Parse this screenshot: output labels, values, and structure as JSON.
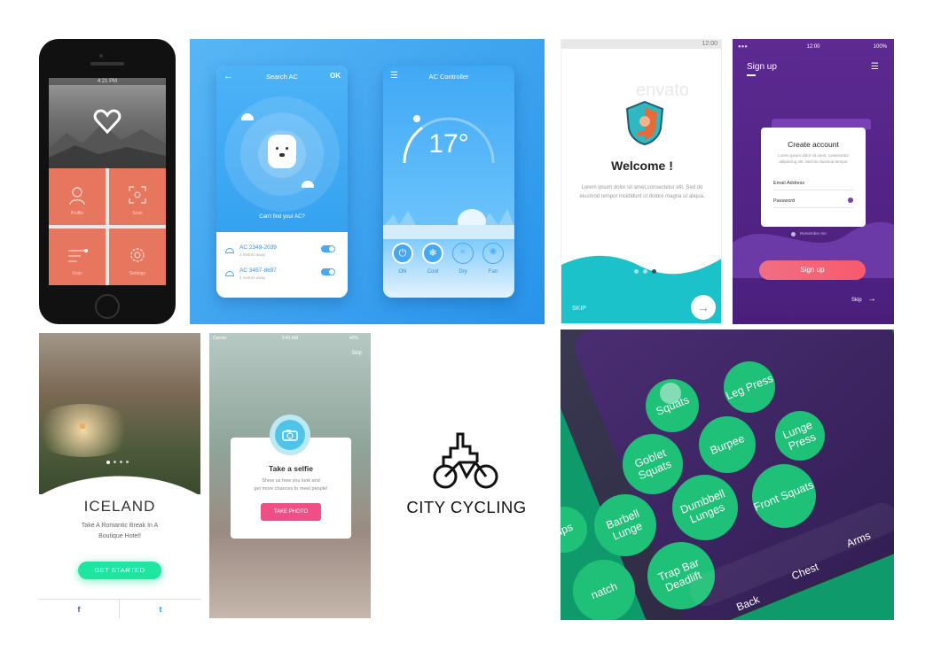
{
  "iphone": {
    "status_time": "4:21 PM",
    "tiles": [
      {
        "label": "Profile",
        "icon": "user-icon"
      },
      {
        "label": "Scan",
        "icon": "scan-icon"
      },
      {
        "label": "Stats",
        "icon": "list-icon"
      },
      {
        "label": "Settings",
        "icon": "gear-icon"
      }
    ]
  },
  "ac_search": {
    "title": "Search AC",
    "ok": "OK",
    "cant_find": "Can't find your AC?",
    "devices": [
      {
        "name": "AC 2349-2039",
        "distance": "2 metres away",
        "on": true
      },
      {
        "name": "AC 3457-8697",
        "distance": "3 metres away",
        "on": true
      }
    ]
  },
  "ac_controller": {
    "title": "AC Controller",
    "temperature": "17°",
    "modes": [
      {
        "label": "ON",
        "icon": "power-icon",
        "active": true
      },
      {
        "label": "Cool",
        "icon": "snowflake-icon",
        "active": true
      },
      {
        "label": "Dry",
        "icon": "waves-icon",
        "active": false
      },
      {
        "label": "Fan",
        "icon": "fan-icon",
        "active": false
      }
    ]
  },
  "envato": {
    "status_time": "12:00",
    "watermark": "envato",
    "welcome": "Welcome !",
    "body": "Lorem ipsum dolor sit amet,consectetur elit. Sed do eiusmod tempor incididunt ut dolore magna ut aliqua.",
    "skip": "SKIP"
  },
  "signup": {
    "status_time": "12:00",
    "battery": "100%",
    "header": "Sign up",
    "card_title": "Create account",
    "card_sub": "Lorem ipsum dolor sit amet, consectetur adipiscing elit. Sed do eiusmod tempor",
    "email_label": "Email Address",
    "password_label": "Password",
    "remember": "Remember me",
    "signup_button": "Sign up",
    "skip": "Skip"
  },
  "iceland": {
    "title": "ICELAND",
    "subtitle_1": "Take A Romantic Break In A",
    "subtitle_2": "Boutique Hotel!",
    "cta": "GET STARTED",
    "social": [
      "f",
      "t"
    ]
  },
  "selfie": {
    "carrier": "Carrier",
    "time": "9:41 AM",
    "battery": "42%",
    "skip": "Skip",
    "title": "Take a selfie",
    "body_1": "Show us how you look and",
    "body_2": "get more chances to meet people!",
    "button": "TAKE PHOTO"
  },
  "city": {
    "title": "CITY CYCLING"
  },
  "workout": {
    "bubbles": [
      "Squats",
      "Leg Press",
      "Goblet Squats",
      "Burpee",
      "Lunge Press",
      "Barbell Lunge",
      "Dumbbell Lunges",
      "Front Squats",
      "Trap Bar Deadlift",
      "ups",
      "natch"
    ],
    "tabs": [
      "Back",
      "Chest",
      "Arms"
    ]
  },
  "colors": {
    "ac_blue": "#2793ea",
    "coral": "#e7765f",
    "signup_purple": "#5c2a91",
    "signup_pink": "#f0607a",
    "envato_teal": "#1bc2c9",
    "iceland_green": "#1ee6a0",
    "selfie_pink": "#ef4f86",
    "workout_green": "#1fc077"
  }
}
